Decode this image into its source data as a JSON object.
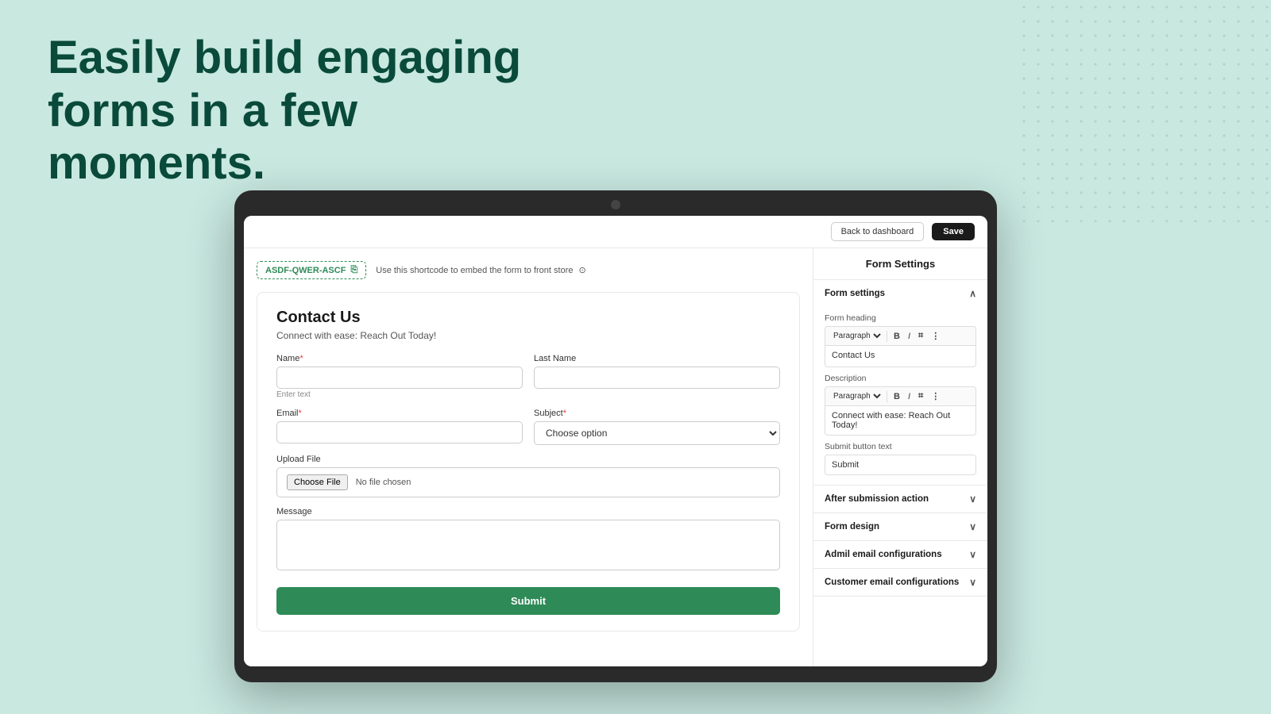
{
  "hero": {
    "title": "Easily build engaging forms in a few moments."
  },
  "topbar": {
    "back_label": "Back to dashboard",
    "save_label": "Save"
  },
  "shortcode": {
    "code": "ASDF-QWER-ASCF",
    "hint": "Use this shortcode to embed the form to front store"
  },
  "form": {
    "title": "Contact Us",
    "subtitle": "Connect with ease: Reach Out Today!",
    "fields": {
      "name_label": "Name",
      "name_hint": "Enter text",
      "lastname_label": "Last Name",
      "email_label": "Email",
      "subject_label": "Subject",
      "subject_placeholder": "Choose option",
      "upload_label": "Upload File",
      "choose_file": "Choose File",
      "no_file": "No file chosen",
      "message_label": "Message"
    },
    "submit_label": "Submit"
  },
  "settings_panel": {
    "title": "Form Settings",
    "form_settings_section": "Form settings",
    "form_heading_label": "Form heading",
    "heading_paragraph_option": "Paragraph",
    "heading_value": "Contact Us",
    "description_label": "Description",
    "description_value": "Connect with ease: Reach Out Today!",
    "submit_button_text_label": "Submit button text",
    "submit_button_value": "Submit",
    "after_submission_label": "After submission action",
    "form_design_label": "Form design",
    "admin_email_label": "Admil email configurations",
    "customer_email_label": "Customer email configurations"
  },
  "icons": {
    "copy": "⎘",
    "info": "⊙",
    "bold": "B",
    "italic": "I",
    "link": "⌗",
    "more": "⋮",
    "chevron_up": "∧",
    "chevron_down": "∨"
  }
}
